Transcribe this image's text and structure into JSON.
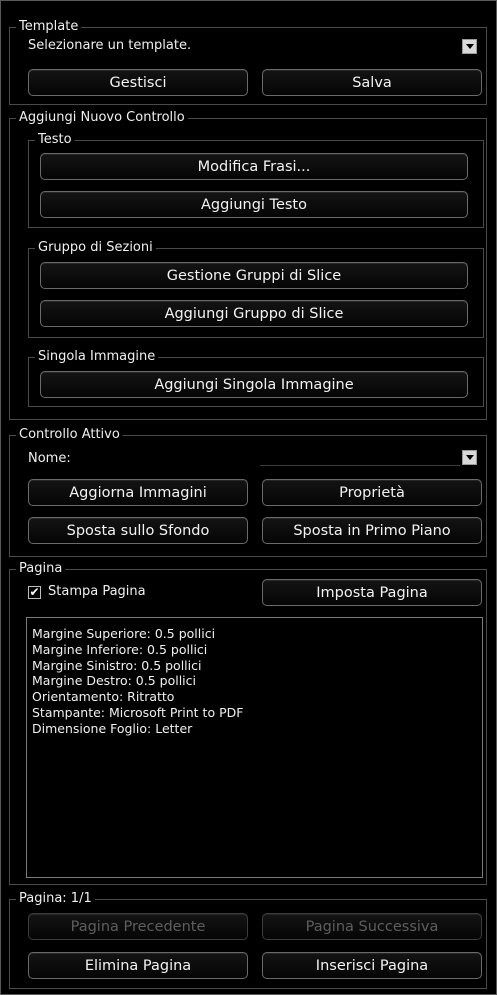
{
  "template": {
    "title": "Template",
    "select_value": "Selezionare un template.",
    "manage_label": "Gestisci",
    "save_label": "Salva"
  },
  "add_control": {
    "title": "Aggiungi Nuovo Controllo",
    "text_group": {
      "title": "Testo",
      "edit_phrases_label": "Modifica Frasi...",
      "add_text_label": "Aggiungi Testo"
    },
    "slice_group": {
      "title": "Gruppo di Sezioni",
      "manage_label": "Gestione Gruppi di Slice",
      "add_label": "Aggiungi Gruppo di Slice"
    },
    "single_image": {
      "title": "Singola Immagine",
      "add_label": "Aggiungi Singola Immagine"
    }
  },
  "active_control": {
    "title": "Controllo Attivo",
    "name_label": "Nome:",
    "name_value": "",
    "refresh_images_label": "Aggiorna Immagini",
    "properties_label": "Proprietà",
    "send_back_label": "Sposta sullo Sfondo",
    "bring_front_label": "Sposta in Primo Piano"
  },
  "page": {
    "title": "Pagina",
    "print_page_label": "Stampa Pagina",
    "print_page_checked": true,
    "setup_label": "Imposta Pagina",
    "info_lines": [
      "Margine Superiore: 0.5 pollici",
      "Margine Inferiore: 0.5 pollici",
      "Margine Sinistro: 0.5 pollici",
      "Margine Destro: 0.5 pollici",
      "Orientamento: Ritratto",
      "Stampante: Microsoft Print to PDF",
      "Dimensione Foglio: Letter"
    ]
  },
  "pagination": {
    "title": "Pagina: 1/1",
    "prev_label": "Pagina Precedente",
    "next_label": "Pagina Successiva",
    "delete_label": "Elimina Pagina",
    "insert_label": "Inserisci Pagina"
  }
}
